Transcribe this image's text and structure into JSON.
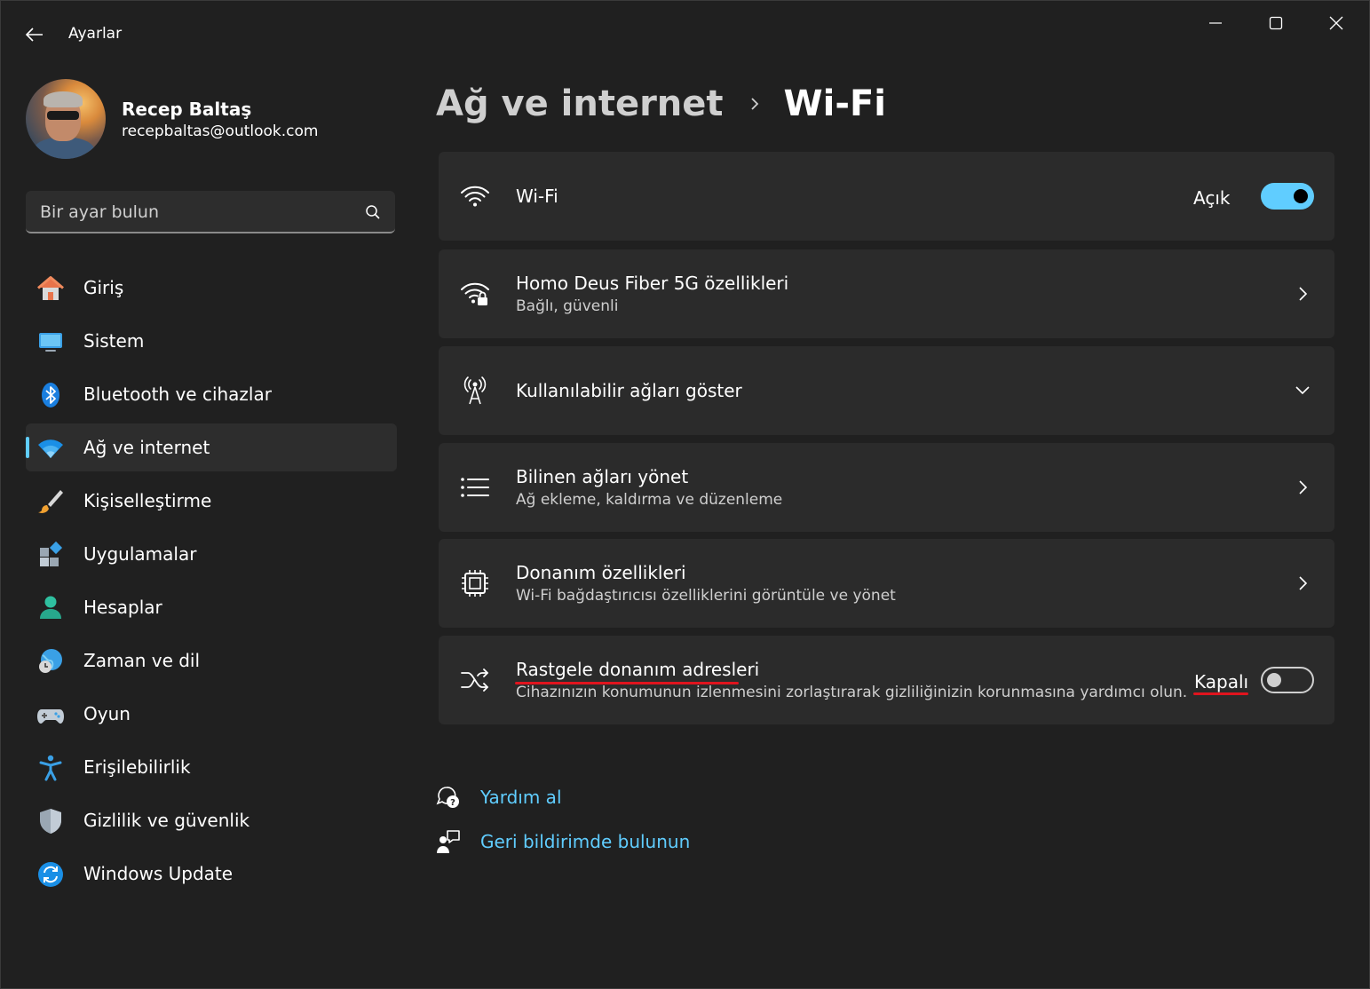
{
  "window": {
    "title": "Ayarlar",
    "controls": [
      "minimize",
      "maximize",
      "close"
    ]
  },
  "user": {
    "name": "Recep Baltaş",
    "email": "recepbaltas@outlook.com"
  },
  "search": {
    "placeholder": "Bir ayar bulun"
  },
  "sidebar": {
    "items": [
      {
        "label": "Giriş",
        "icon": "home-icon"
      },
      {
        "label": "Sistem",
        "icon": "system-icon"
      },
      {
        "label": "Bluetooth ve cihazlar",
        "icon": "bluetooth-icon"
      },
      {
        "label": "Ağ ve internet",
        "icon": "wifi-icon",
        "active": true
      },
      {
        "label": "Kişiselleştirme",
        "icon": "brush-icon"
      },
      {
        "label": "Uygulamalar",
        "icon": "apps-icon"
      },
      {
        "label": "Hesaplar",
        "icon": "person-icon"
      },
      {
        "label": "Zaman ve dil",
        "icon": "globe-clock-icon"
      },
      {
        "label": "Oyun",
        "icon": "gamepad-icon"
      },
      {
        "label": "Erişilebilirlik",
        "icon": "accessibility-icon"
      },
      {
        "label": "Gizlilik ve güvenlik",
        "icon": "shield-icon"
      },
      {
        "label": "Windows Update",
        "icon": "update-icon"
      }
    ]
  },
  "breadcrumb": {
    "parent": "Ağ ve internet",
    "current": "Wi-Fi"
  },
  "cards": {
    "wifi": {
      "title": "Wi-Fi",
      "state": "Açık",
      "on": true
    },
    "network_props": {
      "title": "Homo Deus Fiber 5G özellikleri",
      "subtitle": "Bağlı, güvenli"
    },
    "available": {
      "title": "Kullanılabilir ağları göster"
    },
    "known": {
      "title": "Bilinen ağları yönet",
      "subtitle": "Ağ ekleme, kaldırma ve düzenleme"
    },
    "hardware": {
      "title": "Donanım özellikleri",
      "subtitle": "Wi-Fi bağdaştırıcısı özelliklerini görüntüle ve yönet"
    },
    "random_mac": {
      "title": "Rastgele donanım adresleri",
      "subtitle": "Cihazınızın konumunun izlenmesini zorlaştırarak gizliliğinizin korunmasına yardımcı olun.",
      "state": "Kapalı",
      "on": false
    }
  },
  "links": {
    "help": "Yardım al",
    "feedback": "Geri bildirimde bulunun"
  },
  "colors": {
    "accent": "#60cdff",
    "background": "#202020",
    "card": "#2b2b2b",
    "annotation": "#e0141e"
  }
}
